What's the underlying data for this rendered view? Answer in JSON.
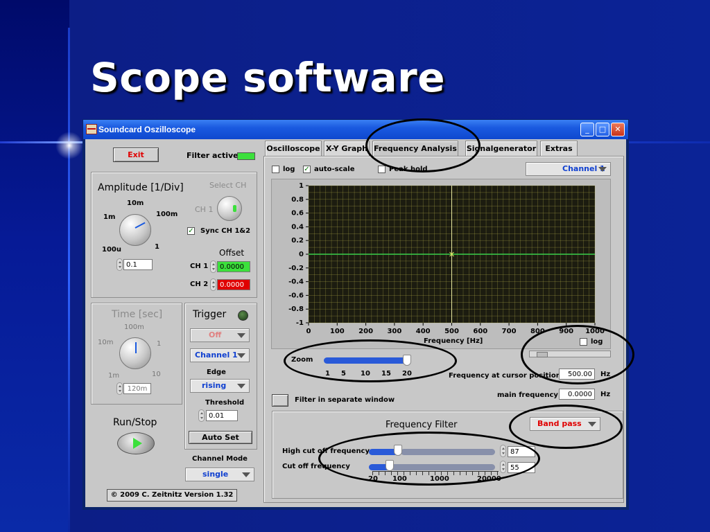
{
  "slide": {
    "title": "Scope software"
  },
  "window": {
    "title": "Soundcard Oszilloscope"
  },
  "left": {
    "exit": "Exit",
    "filter_active": "Filter active",
    "amplitude_title": "Amplitude [1/Div]",
    "select_ch": "Select CH",
    "ch1_switch": "CH 1",
    "knob_labels": {
      "k10m": "10m",
      "k1m": "1m",
      "k100m": "100m",
      "k100u": "100u",
      "k1": "1"
    },
    "sync": "Sync CH 1&2",
    "offset": "Offset",
    "ch1": "CH 1",
    "ch2": "CH 2",
    "ch1_offset": "0.0000",
    "ch2_offset": "0.0000",
    "amp_value": "0.1",
    "time_title": "Time [sec]",
    "time_labels": {
      "t100m": "100m",
      "t10m": "10m",
      "t1": "1",
      "t1m": "1m",
      "t10": "10"
    },
    "time_value": "120m",
    "trigger": "Trigger",
    "trigger_mode": "Off",
    "trigger_channel": "Channel 1",
    "edge": "Edge",
    "edge_value": "rising",
    "threshold": "Threshold",
    "threshold_value": "0.01",
    "auto_set": "Auto Set",
    "run_stop": "Run/Stop",
    "channel_mode": "Channel Mode",
    "channel_mode_value": "single",
    "copyright": "© 2009  C. Zeitnitz Version 1.32"
  },
  "tabs": [
    "Oscilloscope",
    "X-Y Graph",
    "Frequency Analysis",
    "Signalgenerator",
    "Extras"
  ],
  "active_tab": "Frequency Analysis",
  "freq": {
    "log": "log",
    "auto_scale": "auto-scale",
    "peak_hold": "Peak hold",
    "channel": "Channel 1",
    "xlabel": "Frequency [Hz]",
    "xlog": "log",
    "zoom": "Zoom",
    "zoom_ticks": [
      "1",
      "5",
      "10",
      "15",
      "20"
    ],
    "zoom_value": 20,
    "cursor_label": "Frequency at cursor position",
    "cursor_value": "500.00",
    "cursor_unit": "Hz",
    "main_label": "main frequency",
    "main_value": "0.0000",
    "main_unit": "Hz",
    "separate_window": "Filter in separate window"
  },
  "filter": {
    "title": "Frequency Filter",
    "type": "Band pass",
    "high_cut_label": "High cut off frequency",
    "high_cut_value": "87",
    "cut_label": "Cut off frequency",
    "cut_value": "55",
    "scale_ticks": [
      "20",
      "100",
      "1000",
      "20000"
    ]
  },
  "chart_data": {
    "type": "line",
    "xlabel": "Frequency [Hz]",
    "ylabel": "",
    "xlim": [
      0,
      1000
    ],
    "ylim": [
      -1,
      1
    ],
    "x_ticks": [
      "0",
      "100",
      "200",
      "300",
      "400",
      "500",
      "600",
      "700",
      "800",
      "900",
      "1000"
    ],
    "y_ticks": [
      "1",
      "0.8",
      "0.6",
      "0.4",
      "0.2",
      "0",
      "-0.2",
      "-0.4",
      "-0.6",
      "-0.8",
      "-1"
    ],
    "series": [
      {
        "x": [
          0,
          1000
        ],
        "y": [
          0,
          0
        ]
      }
    ],
    "cursor": {
      "x": 500,
      "y": 0
    },
    "grid": true,
    "colors": {
      "background": "#1c1c10",
      "grid": "#b7b24a",
      "trace": "#39d04a"
    }
  },
  "colors": {
    "accent_red": "#e00000",
    "accent_green": "#3ce03c",
    "link_blue": "#1040d0"
  }
}
